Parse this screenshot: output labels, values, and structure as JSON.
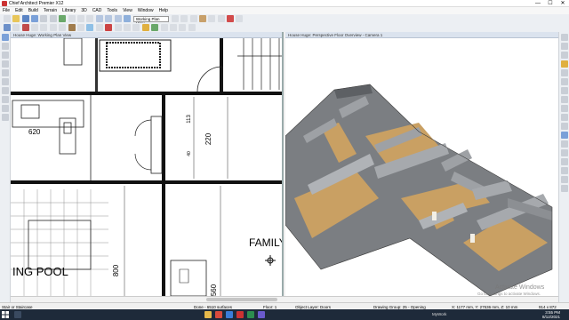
{
  "window": {
    "title": "Chief Architect Premier X12",
    "min": "—",
    "max": "☐",
    "close": "✕"
  },
  "menu": [
    "File",
    "Edit",
    "Build",
    "Terrain",
    "Library",
    "3D",
    "CAD",
    "Tools",
    "View",
    "Window",
    "Help"
  ],
  "toolbar": {
    "view_dropdown": "Working Plan View"
  },
  "panes": {
    "left_title": "House Huge:  Working Plan View",
    "right_title": "House Huge: Perspective Floor Overview - Camera 1"
  },
  "plan": {
    "room_family": "FAMILY",
    "room_pool": "ING POOL",
    "dims": [
      "620",
      "220",
      "800",
      "560",
      "113",
      "40"
    ]
  },
  "status": {
    "left": "Stair or Staircase",
    "surfaces": "Done - 6510 surfaces",
    "floor": "Floor: 1",
    "layer": "Object Layer: Doors",
    "group": "Drawing Group: 25 - Opening",
    "coords": "X: 1177 mm, Y: 27536 mm, Z: 10 mm",
    "size": "914 x 872"
  },
  "activate": {
    "line1": "Activate Windows",
    "line2": "Go to Settings to activate Windows."
  },
  "taskbar": {
    "time": "3:55 PM",
    "date": "8/12/2021",
    "app": "MyWork"
  },
  "colors": {
    "accent": "#3a6fb0",
    "floor": "#c9a063",
    "wall": "#8c8f93"
  }
}
